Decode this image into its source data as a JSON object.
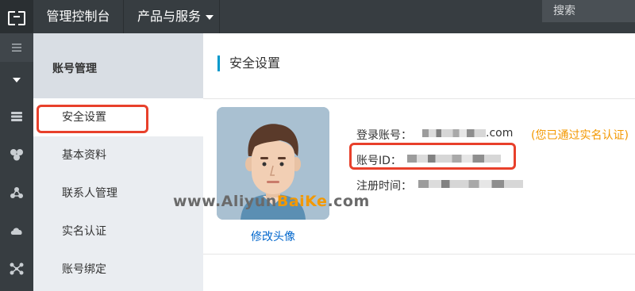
{
  "topbar": {
    "console_title": "管理控制台",
    "products_label": "产品与服务",
    "search_label": "搜索"
  },
  "rail": {
    "icons": [
      "menu-icon",
      "collapse-caret-icon",
      "server-icon",
      "cluster-icon",
      "network-icon",
      "cloud-icon",
      "share-icon"
    ]
  },
  "subnav": {
    "header": "账号管理",
    "items": [
      {
        "label": "安全设置",
        "active": true
      },
      {
        "label": "基本资料",
        "active": false
      },
      {
        "label": "联系人管理",
        "active": false
      },
      {
        "label": "实名认证",
        "active": false
      },
      {
        "label": "账号绑定",
        "active": false
      }
    ]
  },
  "main": {
    "title": "安全设置",
    "change_avatar": "修改头像",
    "login_account_label": "登录账号：",
    "login_account_suffix": ".com",
    "verified_text": "(您已通过实名认证)",
    "account_id_label": "账号ID：",
    "register_time_label": "注册时间："
  },
  "watermark": {
    "prefix": "www.Aliyun",
    "highlight": "BaiKe",
    "suffix": ".com"
  },
  "colors": {
    "topbar": "#373d41",
    "accent": "#0099cc",
    "highlight_box": "#e8402b",
    "verified": "#f39800",
    "link": "#0066cc"
  }
}
